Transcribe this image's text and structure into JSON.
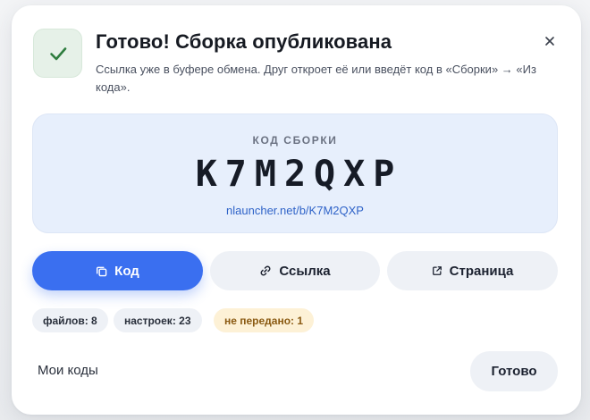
{
  "dialog": {
    "title": "Готово! Сборка опубликована",
    "subtitle": "Ссылка уже в буфере обмена. Друг откроет её или введёт код в «Сборки» → «Из кода».",
    "close_icon": "close-icon",
    "status_icon": "checkmark-icon"
  },
  "code_panel": {
    "caption": "КОД СБОРКИ",
    "code": "K7M2QXP",
    "link": "nlauncher.net/b/K7M2QXP"
  },
  "actions": {
    "copy_code": {
      "label": "Код",
      "icon": "copy-icon"
    },
    "copy_link": {
      "label": "Ссылка",
      "icon": "link-icon"
    },
    "open_page": {
      "label": "Страница",
      "icon": "external-link-icon"
    }
  },
  "stats": {
    "files": "файлов: 8",
    "settings": "настроек: 23",
    "not_transferred": "не передано: 1"
  },
  "footer": {
    "my_codes": "Мои коды",
    "done": "Готово"
  },
  "colors": {
    "accent": "#3a6ff0",
    "success": "#2e7d3e",
    "warning_bg": "#fdf1d6",
    "code_panel_bg": "#e7effc"
  }
}
